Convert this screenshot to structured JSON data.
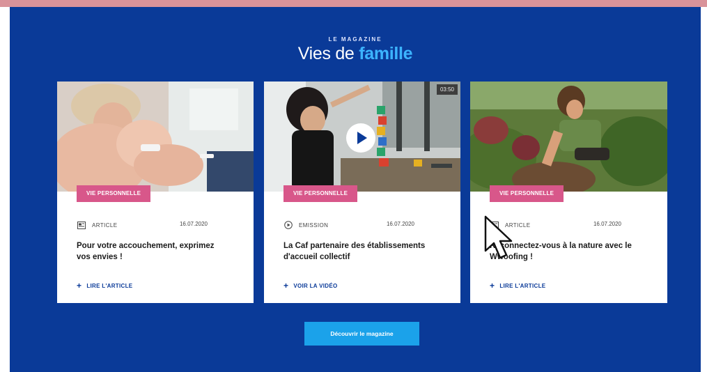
{
  "header": {
    "kicker": "LE MAGAZINE",
    "title_plain": "Vies de",
    "title_accent": "famille"
  },
  "cards": [
    {
      "tag": "VIE PERSONNELLE",
      "icon": "article-icon",
      "type": "ARTICLE",
      "date": "16.07.2020",
      "headline": "Pour votre accouchement, exprimez vos envies !",
      "cta": "LIRE L'ARTICLE"
    },
    {
      "tag": "VIE PERSONNELLE",
      "icon": "play-circle-icon",
      "type": "EMISSION",
      "date": "16.07.2020",
      "headline": "La Caf partenaire des établissements d'accueil collectif",
      "cta": "VOIR LA VIDÉO",
      "duration": "03:50"
    },
    {
      "tag": "VIE PERSONNELLE",
      "icon": "article-icon",
      "type": "ARTICLE",
      "date": "16.07.2020",
      "headline": "Reconnectez-vous à la nature avec le Wwoofing !",
      "cta": "LIRE L'ARTICLE"
    }
  ],
  "button": {
    "label": "Découvrir le magazine"
  },
  "colors": {
    "background": "#0a3a98",
    "accent": "#3cb4ff",
    "tag": "#d8578a",
    "button": "#1ba2ea",
    "top_stripe": "#d9939a"
  }
}
